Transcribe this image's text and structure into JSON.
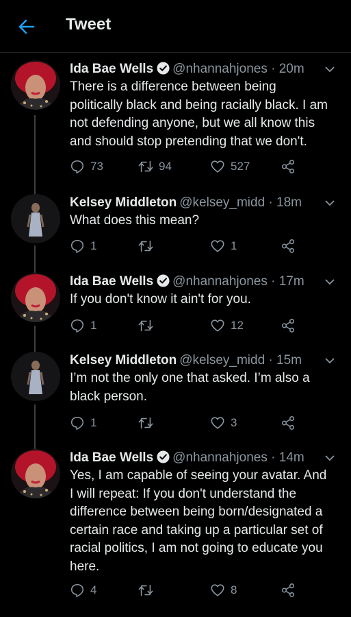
{
  "header": {
    "title": "Tweet"
  },
  "tweets": [
    {
      "name": "Ida Bae Wells",
      "verified": true,
      "handle": "@nhannahjones",
      "time": "· 20m",
      "text": "There is a difference between being politically black and being racially black. I am not defending anyone, but we all know this and should stop pretending that we don't.",
      "replies": "73",
      "retweets": "94",
      "likes": "527"
    },
    {
      "name": "Kelsey Middleton",
      "verified": false,
      "handle": "@kelsey_midd",
      "time": "· 18m",
      "text": "What does this mean?",
      "replies": "1",
      "retweets": "",
      "likes": "1"
    },
    {
      "name": "Ida Bae Wells",
      "verified": true,
      "handle": "@nhannahjones",
      "time": "· 17m",
      "text": "If you don't know it ain't for you.",
      "replies": "1",
      "retweets": "",
      "likes": "12"
    },
    {
      "name": "Kelsey Middleton",
      "verified": false,
      "handle": "@kelsey_midd",
      "time": "· 15m",
      "text": "I’m not the only one that asked. I’m also a black person.",
      "replies": "1",
      "retweets": "",
      "likes": "3"
    },
    {
      "name": "Ida Bae Wells",
      "verified": true,
      "handle": "@nhannahjones",
      "time": "· 14m",
      "text": "Yes, I am capable of seeing your avatar. And I will repeat: If you don't understand the difference between being born/designated a certain race and taking up a particular set of racial politics, I am not going to educate you here.",
      "replies": "4",
      "retweets": "",
      "likes": "8"
    }
  ],
  "colors": {
    "accent": "#1da1f2",
    "muted": "#8b969f",
    "text": "#e6e9ea",
    "background": "#000000"
  }
}
